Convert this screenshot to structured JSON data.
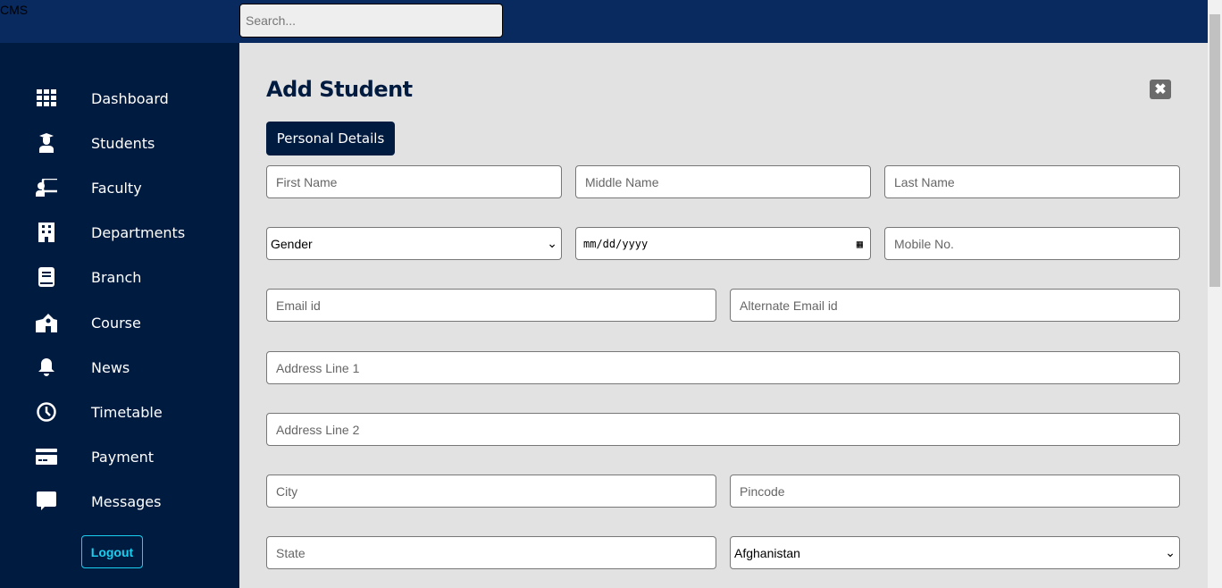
{
  "header": {
    "brand": "CMS",
    "search_placeholder": "Search..."
  },
  "sidebar": {
    "items": [
      {
        "label": "Dashboard",
        "icon": "grid-icon"
      },
      {
        "label": "Students",
        "icon": "graduate-icon"
      },
      {
        "label": "Faculty",
        "icon": "teacher-icon"
      },
      {
        "label": "Departments",
        "icon": "building-icon"
      },
      {
        "label": "Branch",
        "icon": "book-icon"
      },
      {
        "label": "Course",
        "icon": "school-icon"
      },
      {
        "label": "News",
        "icon": "bell-icon"
      },
      {
        "label": "Timetable",
        "icon": "clock-icon"
      },
      {
        "label": "Payment",
        "icon": "credit-card-icon"
      },
      {
        "label": "Messages",
        "icon": "message-icon"
      }
    ],
    "logout": "Logout"
  },
  "form": {
    "title": "Add Student",
    "close": "✖",
    "tab": "Personal Details",
    "first_name": "First Name",
    "middle_name": "Middle Name",
    "last_name": "Last Name",
    "gender": "Gender",
    "dob": "mm/dd/yyyy",
    "mobile": "Mobile No.",
    "email": "Email id",
    "alt_email": "Alternate Email id",
    "address1": "Address Line 1",
    "address2": "Address Line 2",
    "city": "City",
    "pincode": "Pincode",
    "state": "State",
    "country": "Afghanistan"
  }
}
